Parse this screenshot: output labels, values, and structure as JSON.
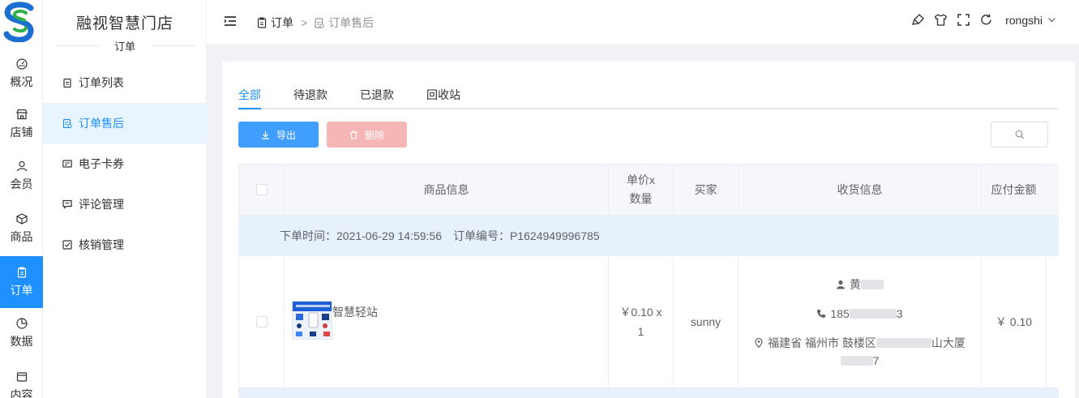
{
  "app": {
    "brand": "融视智慧门店"
  },
  "rail": {
    "items": [
      {
        "label": "概况",
        "icon": "dashboard-icon"
      },
      {
        "label": "店铺",
        "icon": "store-icon"
      },
      {
        "label": "会员",
        "icon": "user-icon"
      },
      {
        "label": "商品",
        "icon": "box-icon"
      },
      {
        "label": "订单",
        "icon": "clipboard-icon",
        "active": true
      },
      {
        "label": "数据",
        "icon": "pie-chart-icon"
      },
      {
        "label": "内容",
        "icon": "image-icon"
      }
    ]
  },
  "subnav": {
    "group_title": "订单",
    "items": [
      {
        "label": "订单列表",
        "icon": "clipboard-icon"
      },
      {
        "label": "订单售后",
        "icon": "clipboard-return-icon",
        "active": true
      },
      {
        "label": "电子卡券",
        "icon": "card-icon"
      },
      {
        "label": "评论管理",
        "icon": "comment-icon"
      },
      {
        "label": "核销管理",
        "icon": "checkbox-icon"
      }
    ]
  },
  "header": {
    "breadcrumb": {
      "first": "订单",
      "separator": ">",
      "current": "订单售后"
    },
    "username": "rongshi"
  },
  "tabs": [
    {
      "label": "全部",
      "active": true
    },
    {
      "label": "待退款"
    },
    {
      "label": "已退款"
    },
    {
      "label": "回收站"
    }
  ],
  "actions": {
    "export": "导出",
    "delete": "删除"
  },
  "table": {
    "columns": {
      "product": "商品信息",
      "price_qty": "单价x数量",
      "buyer": "买家",
      "shipping": "收货信息",
      "payable": "应付金额"
    },
    "group": {
      "order_time_label": "下单时间：2021-06-29 14:59:56",
      "order_no_label": "订单编号：P1624949996785"
    },
    "row": {
      "product_name": "智慧轻站",
      "price": "￥0.10 x",
      "qty": "1",
      "buyer": "sunny",
      "receiver_name": "黄",
      "receiver_phone_prefix": "185",
      "receiver_phone_suffix": "3",
      "address_start": "福建省 福州市 鼓楼区",
      "address_mid": "山大厦",
      "address_tail": "7",
      "payable": "￥ 0.10"
    }
  },
  "colors": {
    "primary": "#1e90ff",
    "danger_disabled": "#f7b6b6",
    "group_row": "#e6f1fc"
  }
}
